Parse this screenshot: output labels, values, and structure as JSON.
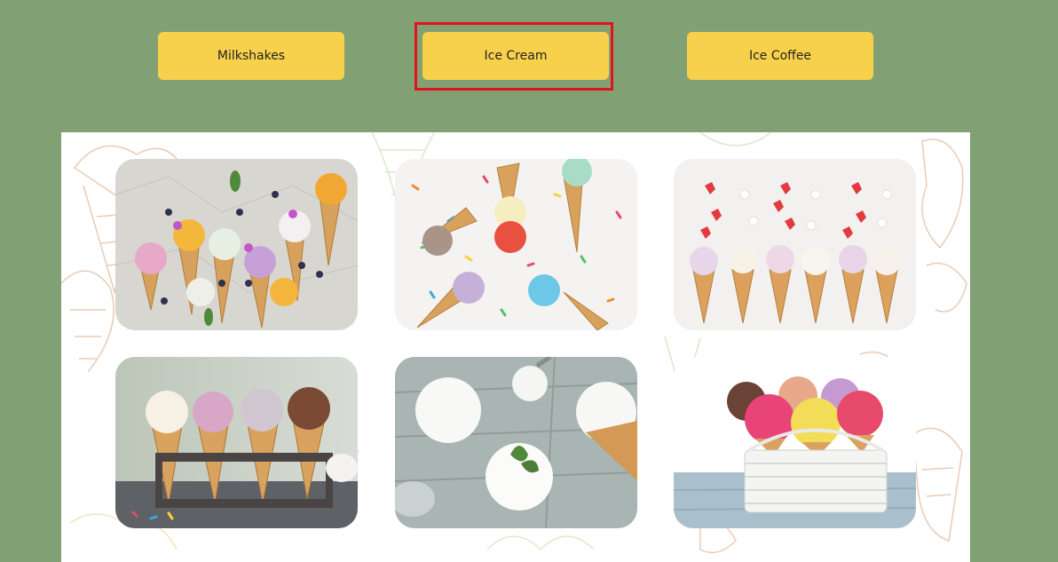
{
  "tabs": [
    {
      "label": "Milkshakes",
      "selected": false
    },
    {
      "label": "Ice Cream",
      "selected": true
    },
    {
      "label": "Ice Coffee",
      "selected": false
    }
  ],
  "colors": {
    "background": "#81a174",
    "tab": "#f8d14c",
    "highlight": "#e0141a",
    "gallery": "#ffffff"
  },
  "gallery": {
    "images": [
      {
        "name": "ice-cream-cones-with-berries-and-flowers"
      },
      {
        "name": "ice-cream-cones-with-sprinkles"
      },
      {
        "name": "ice-cream-cones-with-strawberries"
      },
      {
        "name": "ice-cream-cones-in-wooden-stand"
      },
      {
        "name": "vanilla-ice-cream-scoops-on-wood"
      },
      {
        "name": "ice-cream-cones-in-white-basket"
      }
    ]
  }
}
